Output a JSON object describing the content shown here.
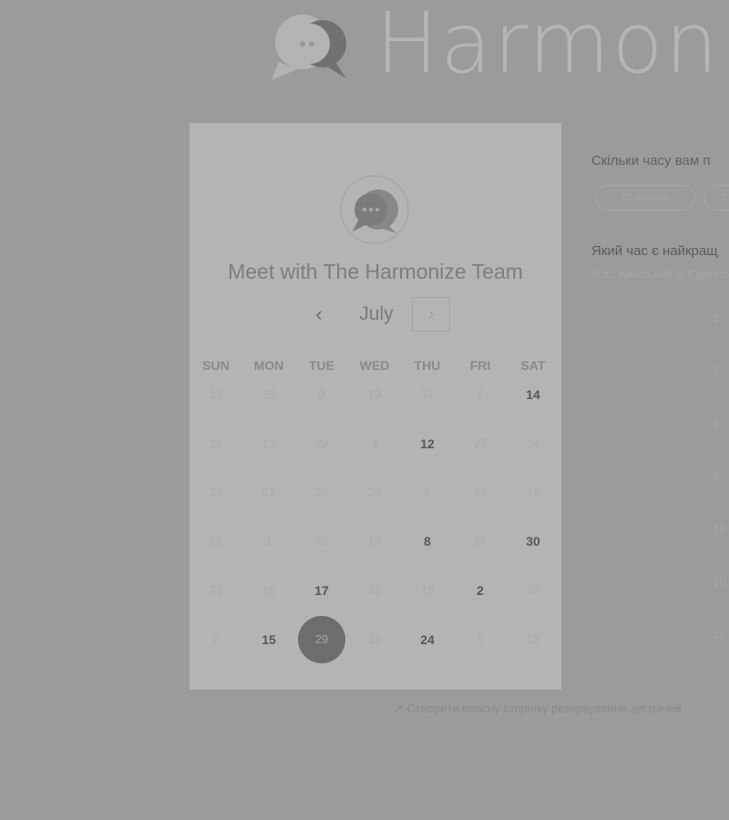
{
  "brand": {
    "name": "Harmon"
  },
  "calendar": {
    "title": "Meet with The Harmonize Team",
    "month": "July",
    "prev_label": "‹",
    "next_label": "›",
    "weekdays": [
      "SUN",
      "MON",
      "TUE",
      "WED",
      "THU",
      "FRI",
      "SAT"
    ],
    "weeks": [
      [
        {
          "d": "13"
        },
        {
          "d": "29"
        },
        {
          "d": "9"
        },
        {
          "d": "19"
        },
        {
          "d": "31"
        },
        {
          "d": "7"
        },
        {
          "d": "14",
          "available": true
        }
      ],
      [
        {
          "d": "18"
        },
        {
          "d": "12"
        },
        {
          "d": "29"
        },
        {
          "d": "4"
        },
        {
          "d": "12",
          "available": true
        },
        {
          "d": "27"
        },
        {
          "d": "24"
        }
      ],
      [
        {
          "d": "22"
        },
        {
          "d": "21"
        },
        {
          "d": "20"
        },
        {
          "d": "20"
        },
        {
          "d": "6"
        },
        {
          "d": "27"
        },
        {
          "d": "19"
        }
      ],
      [
        {
          "d": "21"
        },
        {
          "d": "1"
        },
        {
          "d": "26"
        },
        {
          "d": "15"
        },
        {
          "d": "8",
          "available": true
        },
        {
          "d": "26"
        },
        {
          "d": "30",
          "available": true
        }
      ],
      [
        {
          "d": "31"
        },
        {
          "d": "16"
        },
        {
          "d": "17",
          "available": true
        },
        {
          "d": "22"
        },
        {
          "d": "18"
        },
        {
          "d": "2",
          "available": true
        },
        {
          "d": "26"
        }
      ],
      [
        {
          "d": "2"
        },
        {
          "d": "15",
          "available": true
        },
        {
          "d": "29",
          "selected": true
        },
        {
          "d": "14"
        },
        {
          "d": "24",
          "available": true
        },
        {
          "d": "5"
        },
        {
          "d": "13"
        }
      ]
    ]
  },
  "booking": {
    "duration_question": "Скільки часу вам п",
    "duration_options": [
      "30 хвилин",
      "1"
    ],
    "time_question": "Який час є найкращ",
    "timezone_text": "Ч.п.: Київський зі Єдиносе",
    "time_slots": [
      "9",
      "9",
      "9",
      "9",
      "10",
      "10",
      "11"
    ]
  },
  "footer": {
    "link_text": "Створити власну сторінку резервування зустрічей"
  },
  "colors": {
    "background": "#9b9b9b",
    "card": "#b4b4b4",
    "selected_day": "#6d6d6d"
  }
}
